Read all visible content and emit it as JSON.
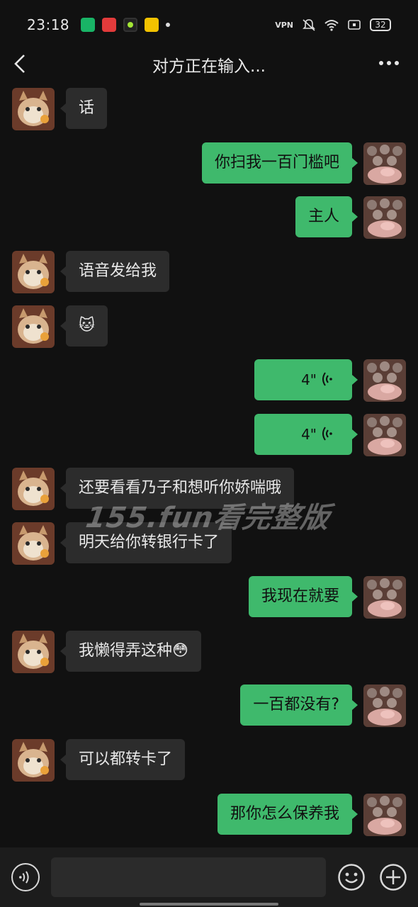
{
  "status_bar": {
    "time": "23:18",
    "network_label": "VPN",
    "battery": "32",
    "notification_icons": [
      "app-icon",
      "netease-music-icon",
      "dark-app-icon",
      "notes-icon"
    ]
  },
  "header": {
    "title": "对方正在输入..."
  },
  "messages": [
    {
      "side": "left",
      "type": "text",
      "text": "话"
    },
    {
      "side": "right",
      "type": "text",
      "text": "你扫我一百门槛吧"
    },
    {
      "side": "right",
      "type": "text",
      "text": "主人"
    },
    {
      "side": "left",
      "type": "text",
      "text": "语音发给我"
    },
    {
      "side": "left",
      "type": "emoji",
      "text": "🐱"
    },
    {
      "side": "right",
      "type": "voice",
      "text": "4\""
    },
    {
      "side": "right",
      "type": "voice",
      "text": "4\""
    },
    {
      "side": "left",
      "type": "text",
      "text": "还要看看乃子和想听你娇喘哦"
    },
    {
      "side": "left",
      "type": "text",
      "text": "明天给你转银行卡了"
    },
    {
      "side": "right",
      "type": "text",
      "text": "我现在就要"
    },
    {
      "side": "left",
      "type": "text",
      "text": "我懒得弄这种😳"
    },
    {
      "side": "right",
      "type": "text",
      "text": "一百都没有?"
    },
    {
      "side": "left",
      "type": "text",
      "text": "可以都转卡了"
    },
    {
      "side": "right",
      "type": "text",
      "text": "那你怎么保养我"
    }
  ],
  "watermark": "155.fun看完整版",
  "colors": {
    "background": "#111111",
    "sent_bubble": "#3fb96c",
    "received_bubble": "#2c2c2c"
  }
}
